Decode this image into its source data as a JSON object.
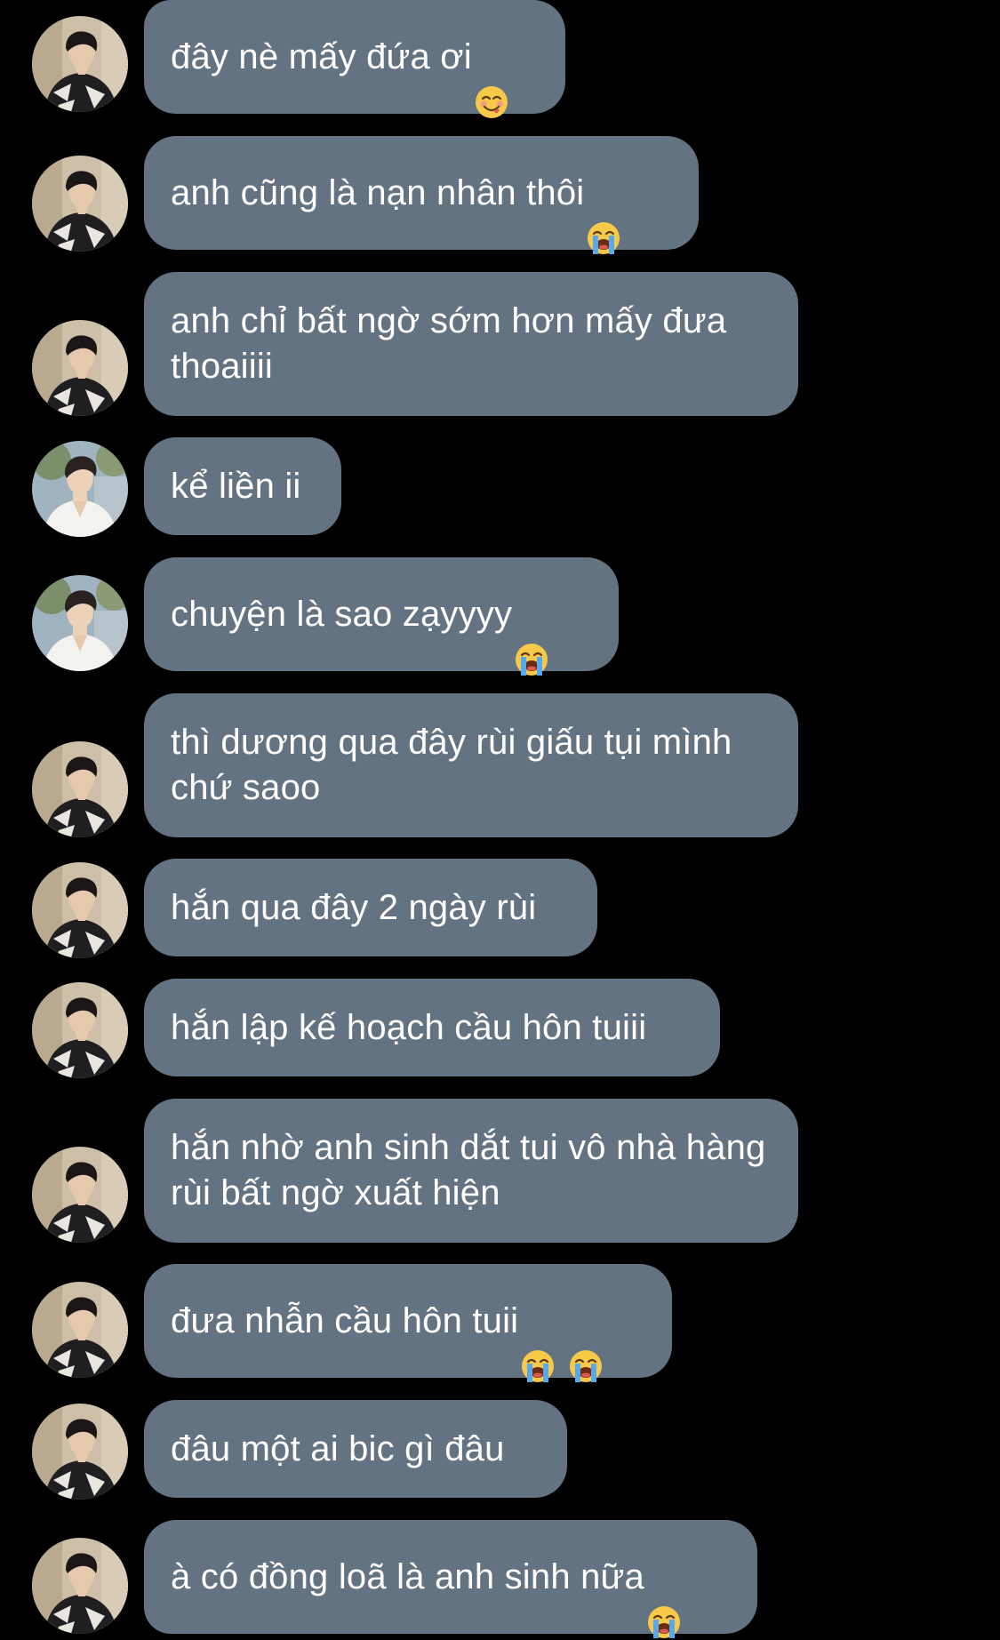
{
  "theme": {
    "background": "#000000",
    "bubble_color": "#647382",
    "text_color": "#ffffff"
  },
  "participants": {
    "person_a": {
      "avatar_icon": "avatar-person-dark-sweater-icon"
    },
    "person_b": {
      "avatar_icon": "avatar-person-white-shirt-icon"
    }
  },
  "messages": [
    {
      "sender": "person_a",
      "text": "đây nè mấy đứa ơi",
      "emojis": [
        "smiling-face-savoring-food-emoji"
      ]
    },
    {
      "sender": "person_a",
      "text": "anh cũng là nạn nhân thôi",
      "emojis": [
        "loudly-crying-face-emoji"
      ]
    },
    {
      "sender": "person_a",
      "text": "anh chỉ bất ngờ sớm hơn mấy đưa thoaiiii",
      "emojis": []
    },
    {
      "sender": "person_b",
      "text": "kể liền ii",
      "emojis": []
    },
    {
      "sender": "person_b",
      "text": "chuyện là sao zạyyyy",
      "emojis": [
        "loudly-crying-face-emoji"
      ]
    },
    {
      "sender": "person_a",
      "text": "thì dương qua đây rùi giấu tụi mình chứ saoo",
      "emojis": []
    },
    {
      "sender": "person_a",
      "text": "hắn qua đây 2 ngày rùi",
      "emojis": []
    },
    {
      "sender": "person_a",
      "text": "hắn lập kế hoạch cầu hôn tuiii",
      "emojis": []
    },
    {
      "sender": "person_a",
      "text": "hắn nhờ anh sinh dắt tui vô nhà hàng rùi bất ngờ xuất hiện",
      "emojis": []
    },
    {
      "sender": "person_a",
      "text": "đưa nhẫn cầu hôn tuii",
      "emojis": [
        "loudly-crying-face-emoji",
        "loudly-crying-face-emoji"
      ]
    },
    {
      "sender": "person_a",
      "text": "đâu một ai bic gì đâu",
      "emojis": []
    },
    {
      "sender": "person_a",
      "text": "à có đồng loã là anh sinh nữa",
      "emojis": [
        "loudly-crying-face-emoji"
      ]
    }
  ]
}
